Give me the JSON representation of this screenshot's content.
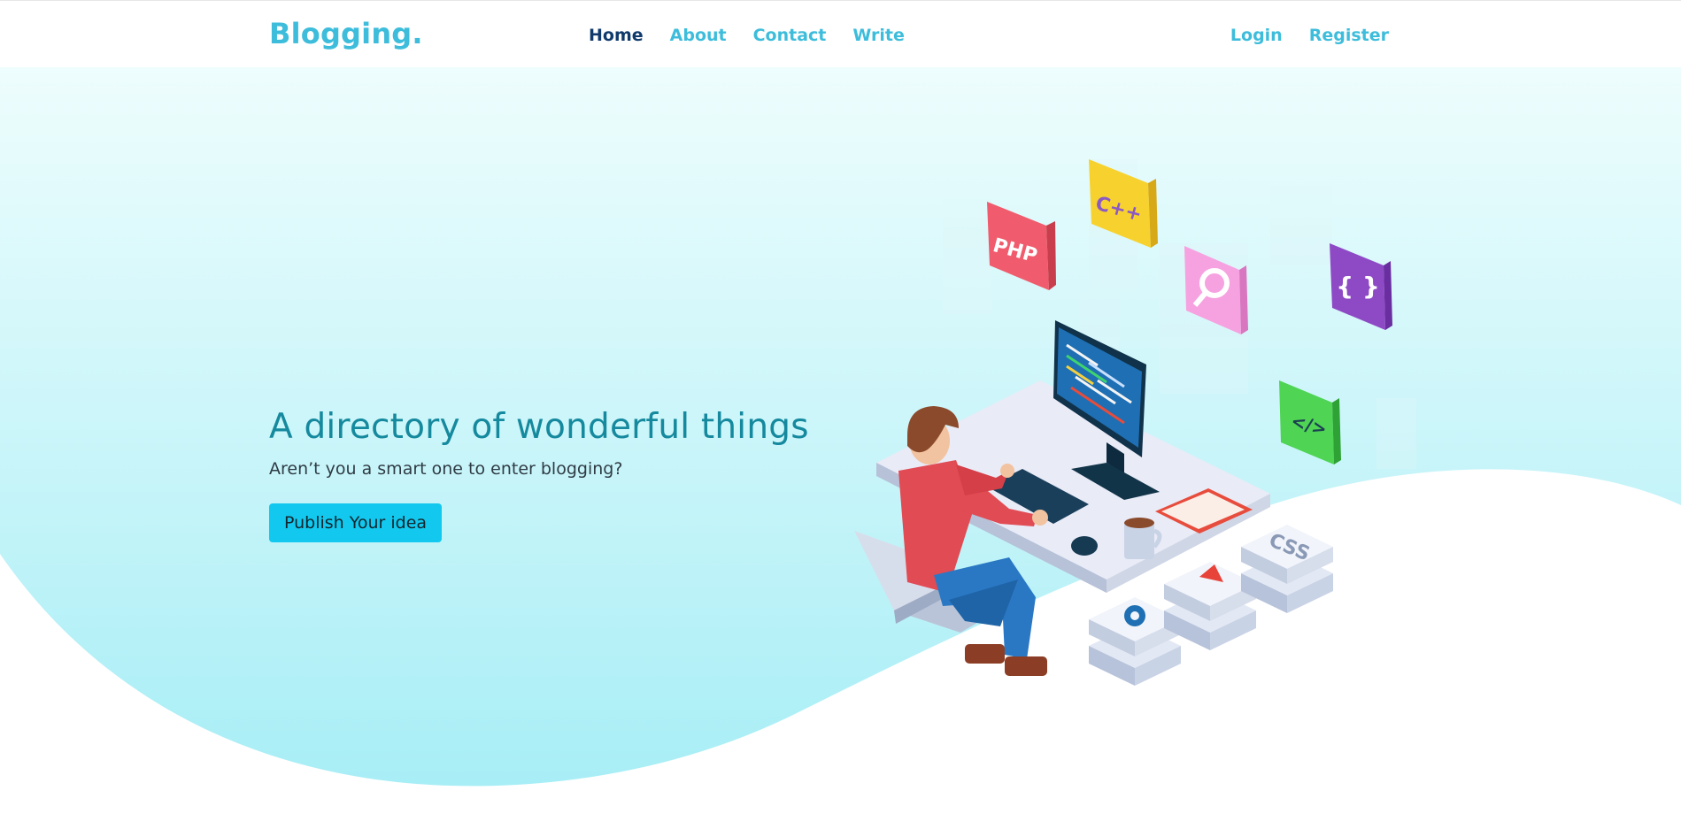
{
  "brand": {
    "name": "Blogging."
  },
  "nav": {
    "items": [
      {
        "label": "Home",
        "active": true
      },
      {
        "label": "About",
        "active": false
      },
      {
        "label": "Contact",
        "active": false
      },
      {
        "label": "Write",
        "active": false
      }
    ]
  },
  "auth": {
    "login": "Login",
    "register": "Register"
  },
  "hero": {
    "title": "A directory of wonderful things",
    "subtitle": "Aren’t you a smart one to enter blogging?",
    "cta_label": "Publish Your idea"
  },
  "illustration": {
    "tiles": {
      "php": "PHP",
      "cpp": "C++",
      "search": "",
      "braces": "{ }",
      "code": "</>",
      "css": "CSS"
    }
  },
  "colors": {
    "brand": "#3dbddb",
    "nav_active": "#0f3a6b",
    "title": "#15899e",
    "cta": "#12c8ee"
  }
}
